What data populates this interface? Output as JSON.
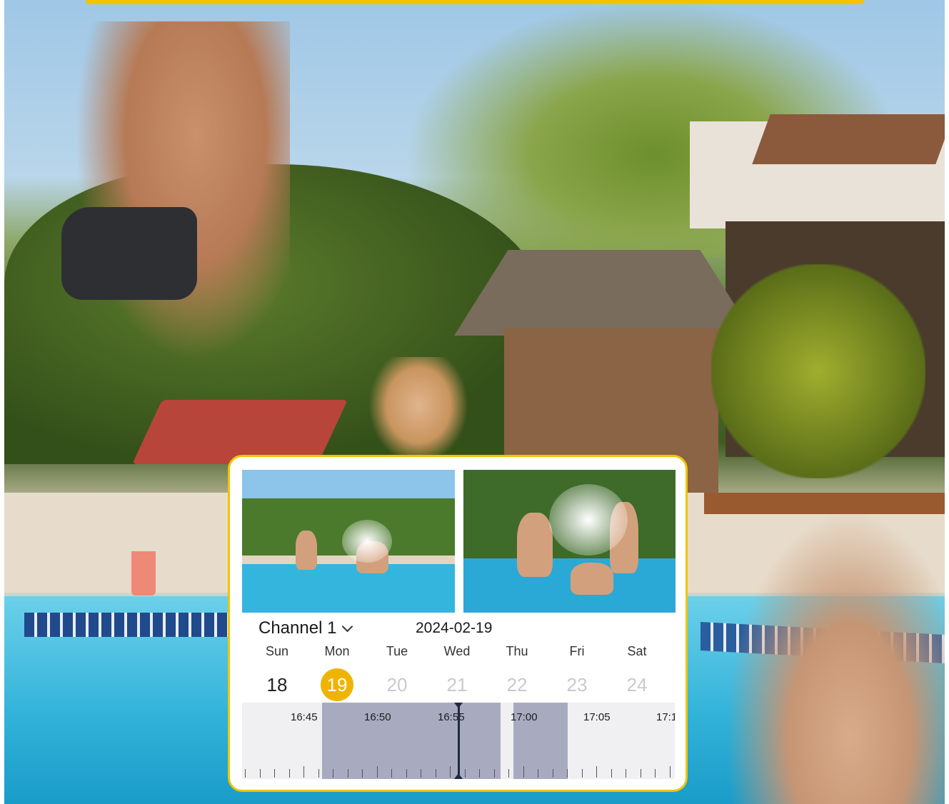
{
  "app": {
    "channel_label": "Channel 1",
    "date": "2024-02-19"
  },
  "week": [
    {
      "name": "Sun",
      "num": "18",
      "state": "normal"
    },
    {
      "name": "Mon",
      "num": "19",
      "state": "selected"
    },
    {
      "name": "Tue",
      "num": "20",
      "state": "disabled"
    },
    {
      "name": "Wed",
      "num": "21",
      "state": "disabled"
    },
    {
      "name": "Thu",
      "num": "22",
      "state": "disabled"
    },
    {
      "name": "Fri",
      "num": "23",
      "state": "disabled"
    },
    {
      "name": "Sat",
      "num": "24",
      "state": "disabled"
    }
  ],
  "timeline": {
    "labels": [
      "16:45",
      "16:50",
      "16:55",
      "17:00",
      "17:05",
      "17:1"
    ]
  },
  "colors": {
    "accent": "#f2c400",
    "selected_day": "#f0b400",
    "recording_segment": "#a8abc0",
    "cursor": "#1e2a44"
  },
  "icons": {
    "dropdown": "chevron-down-icon"
  }
}
